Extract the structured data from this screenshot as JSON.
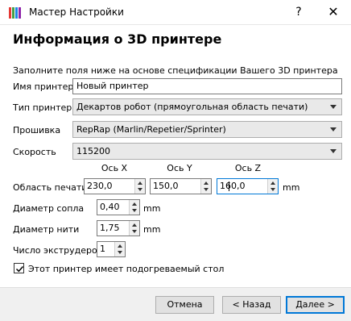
{
  "window": {
    "title": "Мастер Настройки",
    "help_label": "?",
    "close_label": "✕",
    "icon_colors": [
      "#e53935",
      "#43a047",
      "#1e88e5",
      "#8e24aa"
    ]
  },
  "page": {
    "heading": "Информация о 3D принтере",
    "hint": "Заполните поля ниже на основе спецификации Вашего 3D принтера"
  },
  "form": {
    "name_label": "Имя принтера",
    "name_value": "Новый принтер",
    "type_label": "Тип принтера",
    "type_value": "Декартов робот (прямоугольная область печати)",
    "firmware_label": "Прошивка",
    "firmware_value": "RepRap (Marlin/Repetier/Sprinter)",
    "speed_label": "Скорость",
    "speed_value": "115200",
    "axis_x": "Ось X",
    "axis_y": "Ось Y",
    "axis_z": "Ось Z",
    "area_label": "Область печати",
    "area_x": "230,0",
    "area_y": "150,0",
    "area_z": "160,0",
    "area_unit": "mm",
    "nozzle_label": "Диаметр сопла",
    "nozzle_value": "0,40",
    "nozzle_unit": "mm",
    "filament_label": "Диаметр нити",
    "filament_value": "1,75",
    "filament_unit": "mm",
    "extruders_label": "Число экструдеров",
    "extruders_value": "1",
    "heated_bed_label": "Этот принтер имеет подогреваемый стол",
    "heated_bed_checked": true
  },
  "buttons": {
    "cancel": "Отмена",
    "back": "< Назад",
    "next": "Далее >"
  }
}
